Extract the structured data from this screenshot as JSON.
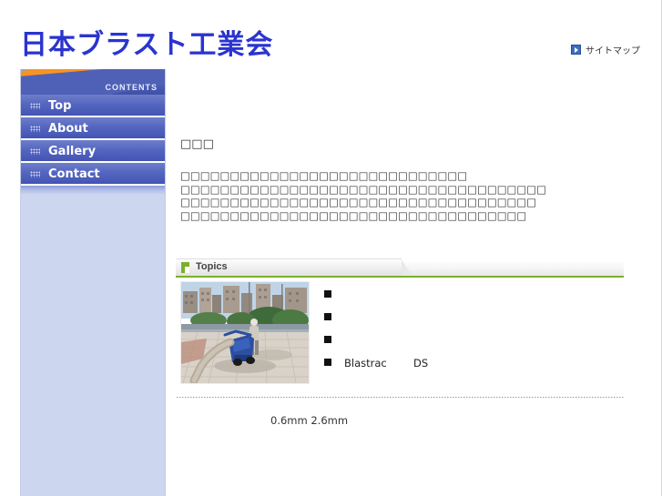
{
  "header": {
    "site_title": "日本ブラスト工業会",
    "sitemap_label": "サイトマップ",
    "sitemap_icon": "play-square-icon",
    "title_color": "#2a34cf"
  },
  "sidebar": {
    "banner_label": "CONTENTS",
    "banner_colors": {
      "orange": "#f79421",
      "blue_light": "#8fa6dd",
      "blue_mid": "#4f61b6",
      "blue_dark": "#3f4fa8"
    },
    "body_color": "#ccd6ef",
    "items": [
      {
        "label": "Top",
        "icon": "dots-grid-icon"
      },
      {
        "label": "About",
        "icon": "dots-grid-icon"
      },
      {
        "label": "Gallery",
        "icon": "dots-grid-icon"
      },
      {
        "label": "Contact",
        "icon": "dots-grid-icon"
      }
    ]
  },
  "main": {
    "intro_heading": "□□□",
    "intro_lines": [
      "□□□□□□□□□□□□□□□□□□□□□□□□□□□□□",
      "□□□□□□□□□□□□□□□□□□□□□□□□□□□□□□□□□□□□□",
      "□□□□□□□□□□□□□□□□□□□□□□□□□□□□□□□□□□□□",
      "□□□□□□□□□□□□□□□□□□□□□□□□□□□□□□□□□□□"
    ]
  },
  "topics": {
    "title": "Topics",
    "flag_icon": "green-flag-icon",
    "accent_color": "#7ab02b",
    "photo_alt": "worker operating blue shot-blasting machine on paved walkway",
    "items": [
      {
        "bullet": "square-bullet-icon",
        "text": ""
      },
      {
        "bullet": "square-bullet-icon",
        "text": ""
      },
      {
        "bullet": "square-bullet-icon",
        "text": ""
      },
      {
        "bullet": "square-bullet-icon",
        "text": "Blastrac        DS"
      }
    ],
    "footnote": "0.6mm 2.6mm"
  }
}
